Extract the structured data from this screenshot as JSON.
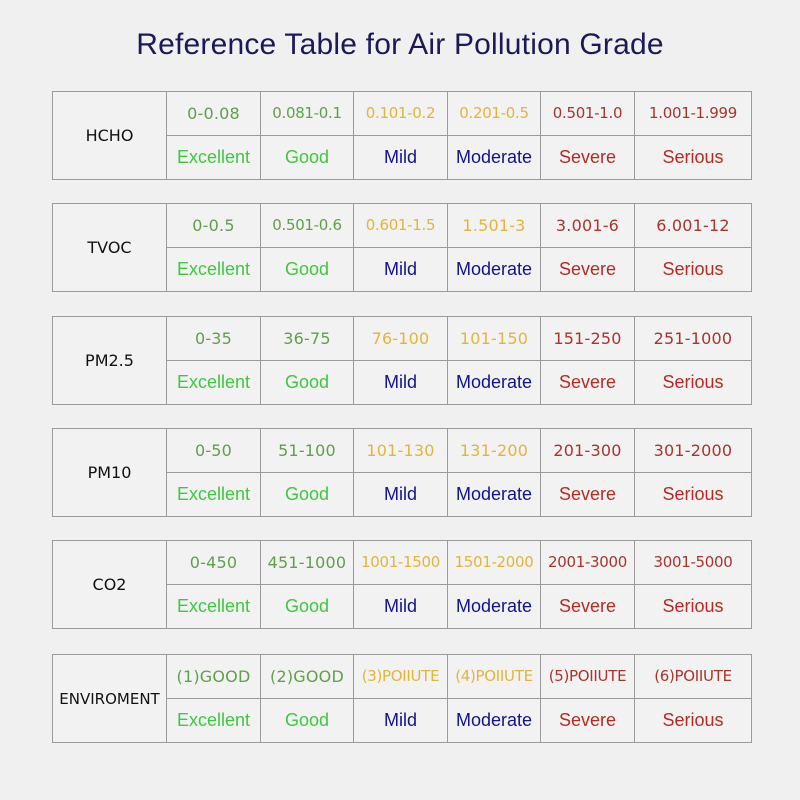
{
  "title": "Reference Table for Air Pollution Grade",
  "colors": {
    "title": "#1c1a55",
    "range_green": "#5fa04a",
    "range_yellow": "#e0b63a",
    "range_red": "#a8342c",
    "grade_green": "#3ec83e",
    "grade_blue": "#12128c",
    "grade_red": "#b52a22"
  },
  "range_color_keys": [
    "range_green",
    "range_green",
    "range_yellow",
    "range_yellow",
    "range_red",
    "range_red"
  ],
  "grade_color_keys": [
    "grade_green",
    "grade_green",
    "grade_blue",
    "grade_blue",
    "grade_red",
    "grade_red"
  ],
  "grades": [
    "Excellent",
    "Good",
    "Mild",
    "Moderate",
    "Severe",
    "Serious"
  ],
  "tables": [
    {
      "pollutant": "HCHO",
      "ranges": [
        "0-0.08",
        "0.081-0.1",
        "0.101-0.2",
        "0.201-0.5",
        "0.501-1.0",
        "1.001-1.999"
      ]
    },
    {
      "pollutant": "TVOC",
      "ranges": [
        "0-0.5",
        "0.501-0.6",
        "0.601-1.5",
        "1.501-3",
        "3.001-6",
        "6.001-12"
      ]
    },
    {
      "pollutant": "PM2.5",
      "ranges": [
        "0-35",
        "36-75",
        "76-100",
        "101-150",
        "151-250",
        "251-1000"
      ]
    },
    {
      "pollutant": "PM10",
      "ranges": [
        "0-50",
        "51-100",
        "101-130",
        "131-200",
        "201-300",
        "301-2000"
      ]
    },
    {
      "pollutant": "CO2",
      "ranges": [
        "0-450",
        "451-1000",
        "1001-1500",
        "1501-2000",
        "2001-3000",
        "3001-5000"
      ]
    },
    {
      "pollutant": "ENVIROMENT",
      "ranges": [
        "(1)GOOD",
        "(2)GOOD",
        "(3)POIIUTE",
        "(4)POIIUTE",
        "(5)POIIUTE",
        "(6)POIIUTE"
      ]
    }
  ]
}
